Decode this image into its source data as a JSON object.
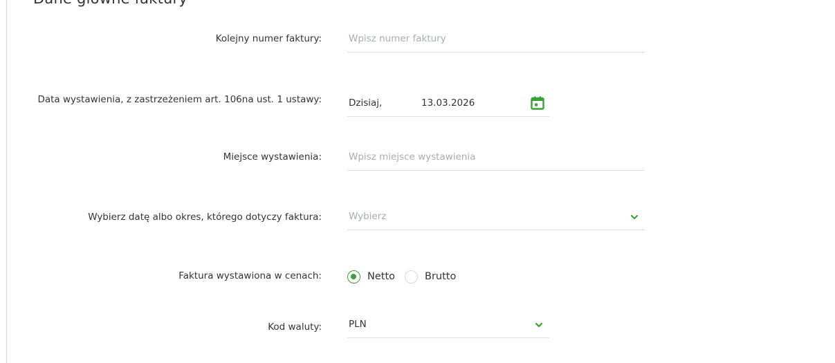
{
  "form": {
    "heading_partial": "Dane główne faktury",
    "invoice_number": {
      "label": "Kolejny numer faktury:",
      "placeholder": "Wpisz numer faktury",
      "value": ""
    },
    "issue_date": {
      "label": "Data wystawienia, z zastrzeżeniem art. 106na ust. 1 ustawy:",
      "prefix": "Dzisiaj,",
      "value": "13.03.2026",
      "icon": "calendar-icon"
    },
    "issue_place": {
      "label": "Miejsce wystawienia:",
      "placeholder": "Wpisz miejsce wystawienia",
      "value": ""
    },
    "period": {
      "label": "Wybierz datę albo okres, którego dotyczy faktura:",
      "placeholder": "Wybierz",
      "icon": "chevron-down-icon"
    },
    "price_type": {
      "label": "Faktura wystawiona w cenach:",
      "options": [
        {
          "label": "Netto",
          "checked": true
        },
        {
          "label": "Brutto",
          "checked": false
        }
      ]
    },
    "currency": {
      "label": "Kod waluty:",
      "value": "PLN",
      "icon": "chevron-down-icon"
    }
  },
  "colors": {
    "accent": "#3aa03a",
    "placeholder": "#a8adb3",
    "underline": "#dcdfe3",
    "text": "#333333"
  }
}
